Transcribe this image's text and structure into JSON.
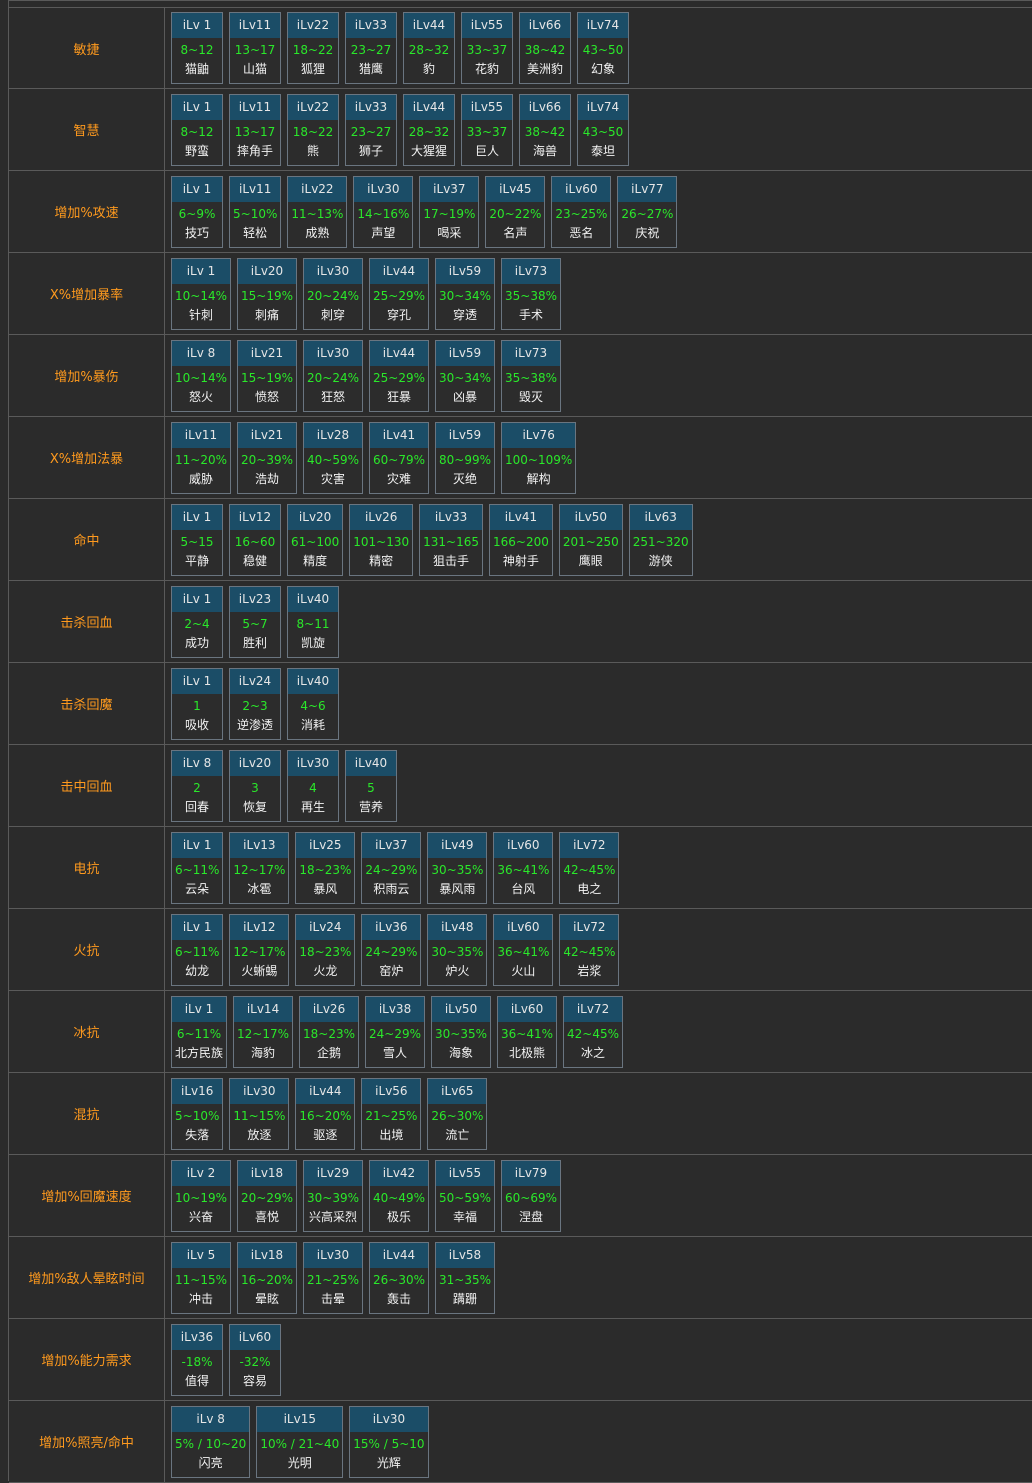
{
  "rows": [
    {
      "label": "敏捷",
      "tiers": [
        {
          "lv": "iLv 1",
          "val": "8~12",
          "name": "猫鼬"
        },
        {
          "lv": "iLv11",
          "val": "13~17",
          "name": "山猫"
        },
        {
          "lv": "iLv22",
          "val": "18~22",
          "name": "狐狸"
        },
        {
          "lv": "iLv33",
          "val": "23~27",
          "name": "猎鹰"
        },
        {
          "lv": "iLv44",
          "val": "28~32",
          "name": "豹"
        },
        {
          "lv": "iLv55",
          "val": "33~37",
          "name": "花豹"
        },
        {
          "lv": "iLv66",
          "val": "38~42",
          "name": "美洲豹"
        },
        {
          "lv": "iLv74",
          "val": "43~50",
          "name": "幻象"
        }
      ]
    },
    {
      "label": "智慧",
      "tiers": [
        {
          "lv": "iLv 1",
          "val": "8~12",
          "name": "野蛮"
        },
        {
          "lv": "iLv11",
          "val": "13~17",
          "name": "摔角手"
        },
        {
          "lv": "iLv22",
          "val": "18~22",
          "name": "熊"
        },
        {
          "lv": "iLv33",
          "val": "23~27",
          "name": "狮子"
        },
        {
          "lv": "iLv44",
          "val": "28~32",
          "name": "大猩猩"
        },
        {
          "lv": "iLv55",
          "val": "33~37",
          "name": "巨人"
        },
        {
          "lv": "iLv66",
          "val": "38~42",
          "name": "海兽"
        },
        {
          "lv": "iLv74",
          "val": "43~50",
          "name": "泰坦"
        }
      ]
    },
    {
      "label": "增加%攻速",
      "tiers": [
        {
          "lv": "iLv 1",
          "val": "6~9%",
          "name": "技巧"
        },
        {
          "lv": "iLv11",
          "val": "5~10%",
          "name": "轻松"
        },
        {
          "lv": "iLv22",
          "val": "11~13%",
          "name": "成熟"
        },
        {
          "lv": "iLv30",
          "val": "14~16%",
          "name": "声望"
        },
        {
          "lv": "iLv37",
          "val": "17~19%",
          "name": "喝采"
        },
        {
          "lv": "iLv45",
          "val": "20~22%",
          "name": "名声"
        },
        {
          "lv": "iLv60",
          "val": "23~25%",
          "name": "恶名"
        },
        {
          "lv": "iLv77",
          "val": "26~27%",
          "name": "庆祝"
        }
      ]
    },
    {
      "label": "X%增加暴率",
      "tiers": [
        {
          "lv": "iLv 1",
          "val": "10~14%",
          "name": "针刺"
        },
        {
          "lv": "iLv20",
          "val": "15~19%",
          "name": "刺痛"
        },
        {
          "lv": "iLv30",
          "val": "20~24%",
          "name": "刺穿"
        },
        {
          "lv": "iLv44",
          "val": "25~29%",
          "name": "穿孔"
        },
        {
          "lv": "iLv59",
          "val": "30~34%",
          "name": "穿透"
        },
        {
          "lv": "iLv73",
          "val": "35~38%",
          "name": "手术"
        }
      ]
    },
    {
      "label": "增加%暴伤",
      "tiers": [
        {
          "lv": "iLv 8",
          "val": "10~14%",
          "name": "怒火"
        },
        {
          "lv": "iLv21",
          "val": "15~19%",
          "name": "愤怒"
        },
        {
          "lv": "iLv30",
          "val": "20~24%",
          "name": "狂怒"
        },
        {
          "lv": "iLv44",
          "val": "25~29%",
          "name": "狂暴"
        },
        {
          "lv": "iLv59",
          "val": "30~34%",
          "name": "凶暴"
        },
        {
          "lv": "iLv73",
          "val": "35~38%",
          "name": "毁灭"
        }
      ]
    },
    {
      "label": "X%增加法暴",
      "tiers": [
        {
          "lv": "iLv11",
          "val": "11~20%",
          "name": "威胁"
        },
        {
          "lv": "iLv21",
          "val": "20~39%",
          "name": "浩劫"
        },
        {
          "lv": "iLv28",
          "val": "40~59%",
          "name": "灾害"
        },
        {
          "lv": "iLv41",
          "val": "60~79%",
          "name": "灾难"
        },
        {
          "lv": "iLv59",
          "val": "80~99%",
          "name": "灭绝"
        },
        {
          "lv": "iLv76",
          "val": "100~109%",
          "name": "解构"
        }
      ]
    },
    {
      "label": "命中",
      "tiers": [
        {
          "lv": "iLv 1",
          "val": "5~15",
          "name": "平静"
        },
        {
          "lv": "iLv12",
          "val": "16~60",
          "name": "稳健"
        },
        {
          "lv": "iLv20",
          "val": "61~100",
          "name": "精度"
        },
        {
          "lv": "iLv26",
          "val": "101~130",
          "name": "精密"
        },
        {
          "lv": "iLv33",
          "val": "131~165",
          "name": "狙击手"
        },
        {
          "lv": "iLv41",
          "val": "166~200",
          "name": "神射手"
        },
        {
          "lv": "iLv50",
          "val": "201~250",
          "name": "鹰眼"
        },
        {
          "lv": "iLv63",
          "val": "251~320",
          "name": "游侠"
        }
      ]
    },
    {
      "label": "击杀回血",
      "tiers": [
        {
          "lv": "iLv 1",
          "val": "2~4",
          "name": "成功"
        },
        {
          "lv": "iLv23",
          "val": "5~7",
          "name": "胜利"
        },
        {
          "lv": "iLv40",
          "val": "8~11",
          "name": "凯旋"
        }
      ]
    },
    {
      "label": "击杀回魔",
      "tiers": [
        {
          "lv": "iLv 1",
          "val": "1",
          "name": "吸收"
        },
        {
          "lv": "iLv24",
          "val": "2~3",
          "name": "逆渗透"
        },
        {
          "lv": "iLv40",
          "val": "4~6",
          "name": "消耗"
        }
      ]
    },
    {
      "label": "击中回血",
      "tiers": [
        {
          "lv": "iLv 8",
          "val": "2",
          "name": "回春"
        },
        {
          "lv": "iLv20",
          "val": "3",
          "name": "恢复"
        },
        {
          "lv": "iLv30",
          "val": "4",
          "name": "再生"
        },
        {
          "lv": "iLv40",
          "val": "5",
          "name": "营养"
        }
      ]
    },
    {
      "label": "电抗",
      "tiers": [
        {
          "lv": "iLv 1",
          "val": "6~11%",
          "name": "云朵"
        },
        {
          "lv": "iLv13",
          "val": "12~17%",
          "name": "冰雹"
        },
        {
          "lv": "iLv25",
          "val": "18~23%",
          "name": "暴风"
        },
        {
          "lv": "iLv37",
          "val": "24~29%",
          "name": "积雨云"
        },
        {
          "lv": "iLv49",
          "val": "30~35%",
          "name": "暴风雨"
        },
        {
          "lv": "iLv60",
          "val": "36~41%",
          "name": "台风"
        },
        {
          "lv": "iLv72",
          "val": "42~45%",
          "name": "电之"
        }
      ]
    },
    {
      "label": "火抗",
      "tiers": [
        {
          "lv": "iLv 1",
          "val": "6~11%",
          "name": "幼龙"
        },
        {
          "lv": "iLv12",
          "val": "12~17%",
          "name": "火蜥蜴"
        },
        {
          "lv": "iLv24",
          "val": "18~23%",
          "name": "火龙"
        },
        {
          "lv": "iLv36",
          "val": "24~29%",
          "name": "窑炉"
        },
        {
          "lv": "iLv48",
          "val": "30~35%",
          "name": "炉火"
        },
        {
          "lv": "iLv60",
          "val": "36~41%",
          "name": "火山"
        },
        {
          "lv": "iLv72",
          "val": "42~45%",
          "name": "岩浆"
        }
      ]
    },
    {
      "label": "冰抗",
      "tiers": [
        {
          "lv": "iLv 1",
          "val": "6~11%",
          "name": "北方民族"
        },
        {
          "lv": "iLv14",
          "val": "12~17%",
          "name": "海豹"
        },
        {
          "lv": "iLv26",
          "val": "18~23%",
          "name": "企鹅"
        },
        {
          "lv": "iLv38",
          "val": "24~29%",
          "name": "雪人"
        },
        {
          "lv": "iLv50",
          "val": "30~35%",
          "name": "海象"
        },
        {
          "lv": "iLv60",
          "val": "36~41%",
          "name": "北极熊"
        },
        {
          "lv": "iLv72",
          "val": "42~45%",
          "name": "冰之"
        }
      ]
    },
    {
      "label": "混抗",
      "tiers": [
        {
          "lv": "iLv16",
          "val": "5~10%",
          "name": "失落"
        },
        {
          "lv": "iLv30",
          "val": "11~15%",
          "name": "放逐"
        },
        {
          "lv": "iLv44",
          "val": "16~20%",
          "name": "驱逐"
        },
        {
          "lv": "iLv56",
          "val": "21~25%",
          "name": "出境"
        },
        {
          "lv": "iLv65",
          "val": "26~30%",
          "name": "流亡"
        }
      ]
    },
    {
      "label": "增加%回魔速度",
      "tiers": [
        {
          "lv": "iLv 2",
          "val": "10~19%",
          "name": "兴奋"
        },
        {
          "lv": "iLv18",
          "val": "20~29%",
          "name": "喜悦"
        },
        {
          "lv": "iLv29",
          "val": "30~39%",
          "name": "兴高采烈"
        },
        {
          "lv": "iLv42",
          "val": "40~49%",
          "name": "极乐"
        },
        {
          "lv": "iLv55",
          "val": "50~59%",
          "name": "幸福"
        },
        {
          "lv": "iLv79",
          "val": "60~69%",
          "name": "涅盘"
        }
      ]
    },
    {
      "label": "增加%敌人晕眩时间",
      "tiers": [
        {
          "lv": "iLv 5",
          "val": "11~15%",
          "name": "冲击"
        },
        {
          "lv": "iLv18",
          "val": "16~20%",
          "name": "晕眩"
        },
        {
          "lv": "iLv30",
          "val": "21~25%",
          "name": "击晕"
        },
        {
          "lv": "iLv44",
          "val": "26~30%",
          "name": "轰击"
        },
        {
          "lv": "iLv58",
          "val": "31~35%",
          "name": "蹒跚"
        }
      ]
    },
    {
      "label": "增加%能力需求",
      "tiers": [
        {
          "lv": "iLv36",
          "val": "-18%",
          "name": "值得"
        },
        {
          "lv": "iLv60",
          "val": "-32%",
          "name": "容易"
        }
      ]
    },
    {
      "label": "增加%照亮/命中",
      "tiers": [
        {
          "lv": "iLv 8",
          "val": "5% / 10~20",
          "name": "闪亮"
        },
        {
          "lv": "iLv15",
          "val": "10% / 21~40",
          "name": "光明"
        },
        {
          "lv": "iLv30",
          "val": "15% / 5~10",
          "name": "光辉"
        }
      ]
    }
  ]
}
